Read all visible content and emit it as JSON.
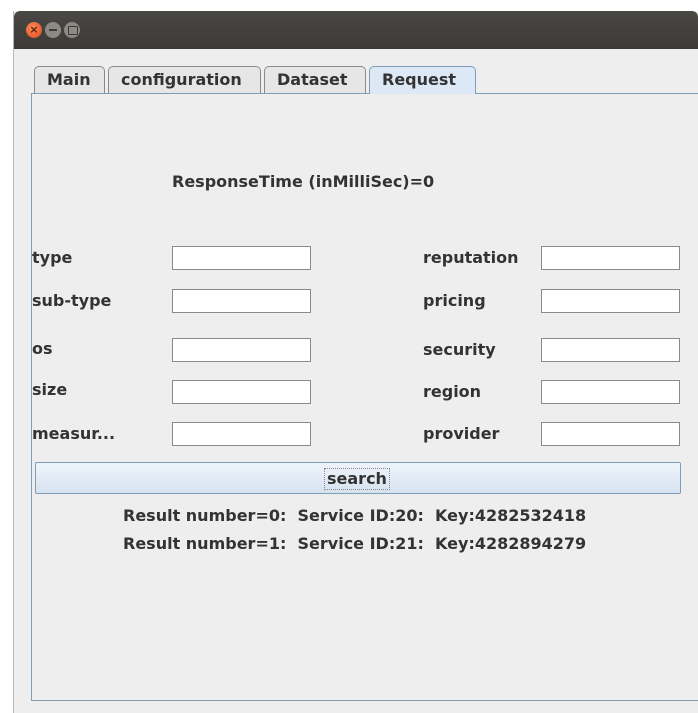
{
  "window": {
    "buttons": {
      "close_glyph": "×"
    }
  },
  "tabs": [
    {
      "label": "Main"
    },
    {
      "label": "configuration"
    },
    {
      "label": "Dataset"
    },
    {
      "label": "Request"
    }
  ],
  "response_time": "ResponseTime (inMilliSec)=0",
  "form": {
    "left": [
      {
        "label": "type",
        "value": ""
      },
      {
        "label": "sub-type",
        "value": ""
      },
      {
        "label": "os",
        "value": ""
      },
      {
        "label": "size",
        "value": ""
      },
      {
        "label": "measur...",
        "value": ""
      }
    ],
    "right": [
      {
        "label": "reputation",
        "value": ""
      },
      {
        "label": "pricing",
        "value": ""
      },
      {
        "label": "security",
        "value": ""
      },
      {
        "label": "region",
        "value": ""
      },
      {
        "label": "provider",
        "value": ""
      }
    ]
  },
  "search_label": "search",
  "results": [
    "Result number=0:  Service ID:20:  Key:4282532418",
    "Result number=1:  Service ID:21:  Key:4282894279"
  ],
  "colors": {
    "accent": "#7f9db9",
    "selected_tab": "#dce8f5",
    "close": "#e0491a"
  }
}
